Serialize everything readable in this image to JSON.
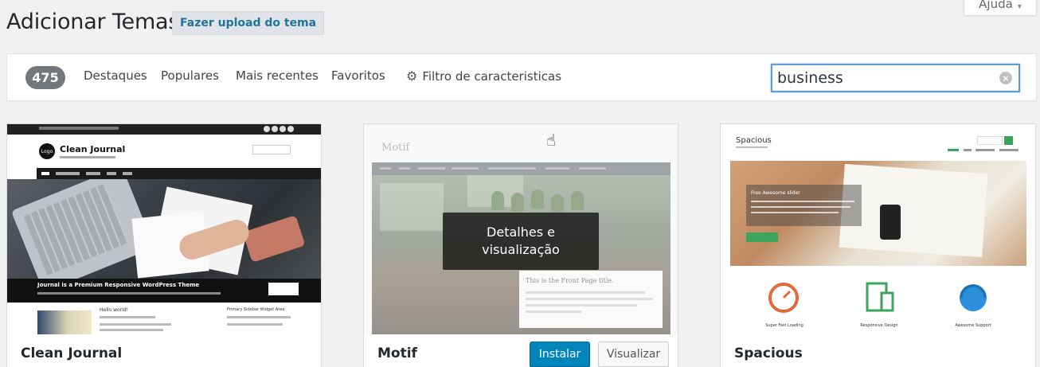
{
  "help_tab": {
    "label": "Ajuda",
    "caret": "▾"
  },
  "page_title": "Adicionar Temas",
  "upload_button": "Fazer upload do tema",
  "filter_bar": {
    "count": "475",
    "links": [
      "Destaques",
      "Populares",
      "Mais recentes",
      "Favoritos"
    ],
    "feature_filter": "Filtro de caracteristicas",
    "search_value": "business",
    "clear_icon": "×"
  },
  "themes": [
    {
      "name": "Clean Journal",
      "screenshot": {
        "logo_text": "Logo",
        "site_title": "Clean Journal",
        "hero_caption": "Journal is a Premium Responsive WordPress Theme",
        "post_title": "Hello world!",
        "widget_title": "Primary Sidebar Widget Area"
      }
    },
    {
      "name": "Motif",
      "overlay": "Detalhes e visualização",
      "install_button": "Instalar",
      "preview_button": "Visualizar",
      "screenshot": {
        "logo_text": "Motif",
        "panel_title": "This is the Front Page title."
      }
    },
    {
      "name": "Spacious",
      "screenshot": {
        "site_title": "Spacious",
        "slider_title": "Free Awesome slider",
        "features": [
          "Super Fast Loading",
          "Responsive Design",
          "Awesome Support"
        ]
      }
    }
  ],
  "colors": {
    "primary_button": "#0085ba",
    "link": "#21759b",
    "badge": "#72777c",
    "focus": "#5b9dd9"
  }
}
